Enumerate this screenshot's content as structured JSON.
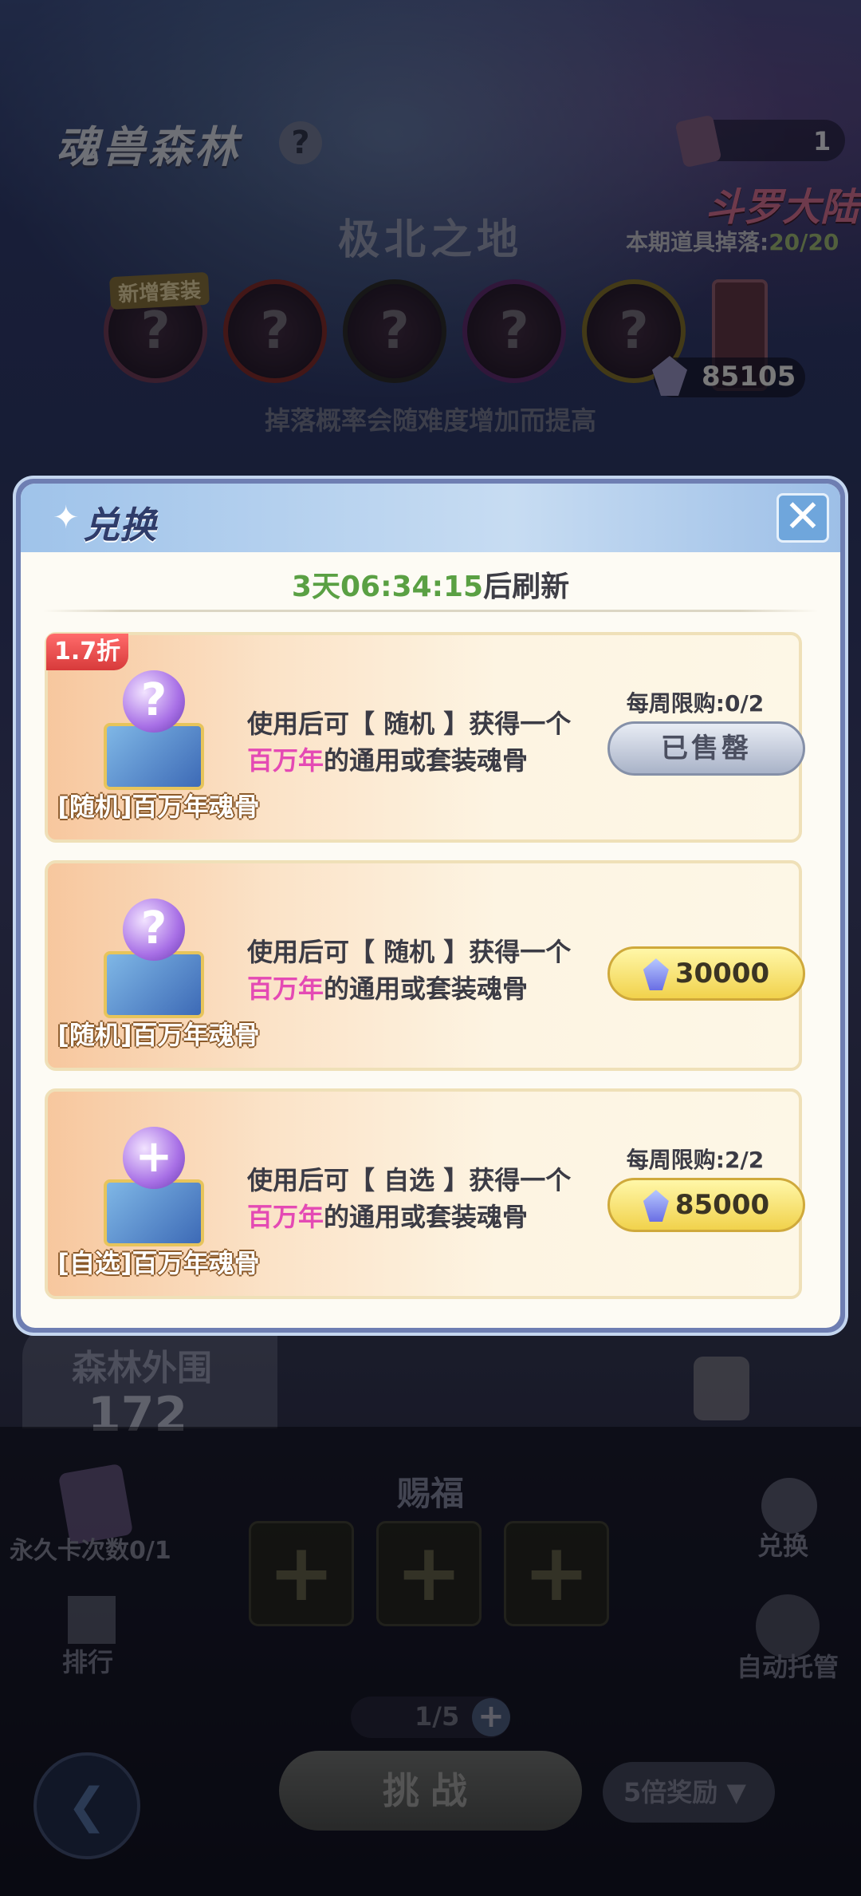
{
  "header": {
    "zone_title": "魂兽森林",
    "help_icon": "?",
    "ticket_count": "1",
    "game_logo": "斗罗大陆",
    "drop_label": "本期道具掉落:",
    "drop_value": "20/20",
    "region_title": "极北之地",
    "new_tag": "新增套装",
    "bone_placeholder": "?",
    "gem_balance": "85105",
    "drop_hint": "掉落概率会随难度增加而提高"
  },
  "modal": {
    "title": "兑换",
    "close_icon": "close-icon",
    "timer_value": "3天06:34:15",
    "timer_suffix": "后刷新",
    "items": [
      {
        "discount": "1.7折",
        "name": "[随机]百万年魂骨",
        "orb_symbol": "?",
        "desc_prefix": "使用后可【 随机 】获得一个",
        "desc_highlight": "百万年",
        "desc_suffix": "的通用或套装魂骨",
        "limit": "每周限购:0/2",
        "button": "已售罄"
      },
      {
        "name": "[随机]百万年魂骨",
        "orb_symbol": "?",
        "desc_prefix": "使用后可【 随机 】获得一个",
        "desc_highlight": "百万年",
        "desc_suffix": "的通用或套装魂骨",
        "price": "30000"
      },
      {
        "name": "[自选]百万年魂骨",
        "orb_symbol": "+",
        "desc_prefix": "使用后可【 自选 】获得一个",
        "desc_highlight": "百万年",
        "desc_suffix": "的通用或套装魂骨",
        "limit": "每周限购:2/2",
        "price": "85000"
      }
    ]
  },
  "bottom": {
    "forest_name": "森林外围",
    "forest_num": "172",
    "perm_card_label": "永久卡次数0/1",
    "bless_title": "赐福",
    "slot_symbol": "+",
    "exchange_label": "兑换",
    "rank_label": "排行",
    "auto_label": "自动托管",
    "stamina": "1/5",
    "stamina_plus": "+",
    "challenge": "挑战",
    "reward_multiplier": "5倍奖励"
  },
  "colors": {
    "accent_green": "#5aa043",
    "highlight_pink": "#e44ab4",
    "discount_red": "#d73a3a",
    "modal_header_blue": "#9fc3ea"
  }
}
